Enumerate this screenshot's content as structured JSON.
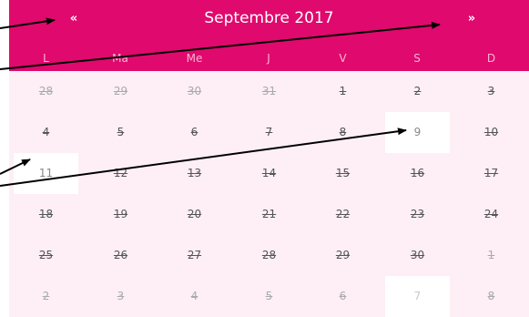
{
  "calendar": {
    "title": "Septembre 2017",
    "prev_label": "«",
    "next_label": "»",
    "weekdays": [
      "L",
      "Ma",
      "Me",
      "J",
      "V",
      "S",
      "D"
    ],
    "weeks": [
      [
        {
          "label": "28",
          "other_month": true,
          "available": false
        },
        {
          "label": "29",
          "other_month": true,
          "available": false
        },
        {
          "label": "30",
          "other_month": true,
          "available": false
        },
        {
          "label": "31",
          "other_month": true,
          "available": false
        },
        {
          "label": "1",
          "other_month": false,
          "available": false
        },
        {
          "label": "2",
          "other_month": false,
          "available": false
        },
        {
          "label": "3",
          "other_month": false,
          "available": false
        }
      ],
      [
        {
          "label": "4",
          "other_month": false,
          "available": false
        },
        {
          "label": "5",
          "other_month": false,
          "available": false
        },
        {
          "label": "6",
          "other_month": false,
          "available": false
        },
        {
          "label": "7",
          "other_month": false,
          "available": false
        },
        {
          "label": "8",
          "other_month": false,
          "available": false
        },
        {
          "label": "9",
          "other_month": false,
          "available": true
        },
        {
          "label": "10",
          "other_month": false,
          "available": false
        }
      ],
      [
        {
          "label": "11",
          "other_month": false,
          "available": true
        },
        {
          "label": "12",
          "other_month": false,
          "available": false
        },
        {
          "label": "13",
          "other_month": false,
          "available": false
        },
        {
          "label": "14",
          "other_month": false,
          "available": false
        },
        {
          "label": "15",
          "other_month": false,
          "available": false
        },
        {
          "label": "16",
          "other_month": false,
          "available": false
        },
        {
          "label": "17",
          "other_month": false,
          "available": false
        }
      ],
      [
        {
          "label": "18",
          "other_month": false,
          "available": false
        },
        {
          "label": "19",
          "other_month": false,
          "available": false
        },
        {
          "label": "20",
          "other_month": false,
          "available": false
        },
        {
          "label": "21",
          "other_month": false,
          "available": false
        },
        {
          "label": "22",
          "other_month": false,
          "available": false
        },
        {
          "label": "23",
          "other_month": false,
          "available": false
        },
        {
          "label": "24",
          "other_month": false,
          "available": false
        }
      ],
      [
        {
          "label": "25",
          "other_month": false,
          "available": false
        },
        {
          "label": "26",
          "other_month": false,
          "available": false
        },
        {
          "label": "27",
          "other_month": false,
          "available": false
        },
        {
          "label": "28",
          "other_month": false,
          "available": false
        },
        {
          "label": "29",
          "other_month": false,
          "available": false
        },
        {
          "label": "30",
          "other_month": false,
          "available": false
        },
        {
          "label": "1",
          "other_month": true,
          "available": false
        }
      ],
      [
        {
          "label": "2",
          "other_month": true,
          "available": false
        },
        {
          "label": "3",
          "other_month": true,
          "available": false
        },
        {
          "label": "4",
          "other_month": true,
          "available": false
        },
        {
          "label": "5",
          "other_month": true,
          "available": false
        },
        {
          "label": "6",
          "other_month": true,
          "available": false
        },
        {
          "label": "7",
          "other_month": true,
          "available": true
        },
        {
          "label": "8",
          "other_month": true,
          "available": false
        }
      ]
    ]
  },
  "colors": {
    "header": "#e0096e",
    "body": "#fdeff5",
    "weekday_text": "#f7b6d3",
    "available_cell": "#ffffff"
  }
}
